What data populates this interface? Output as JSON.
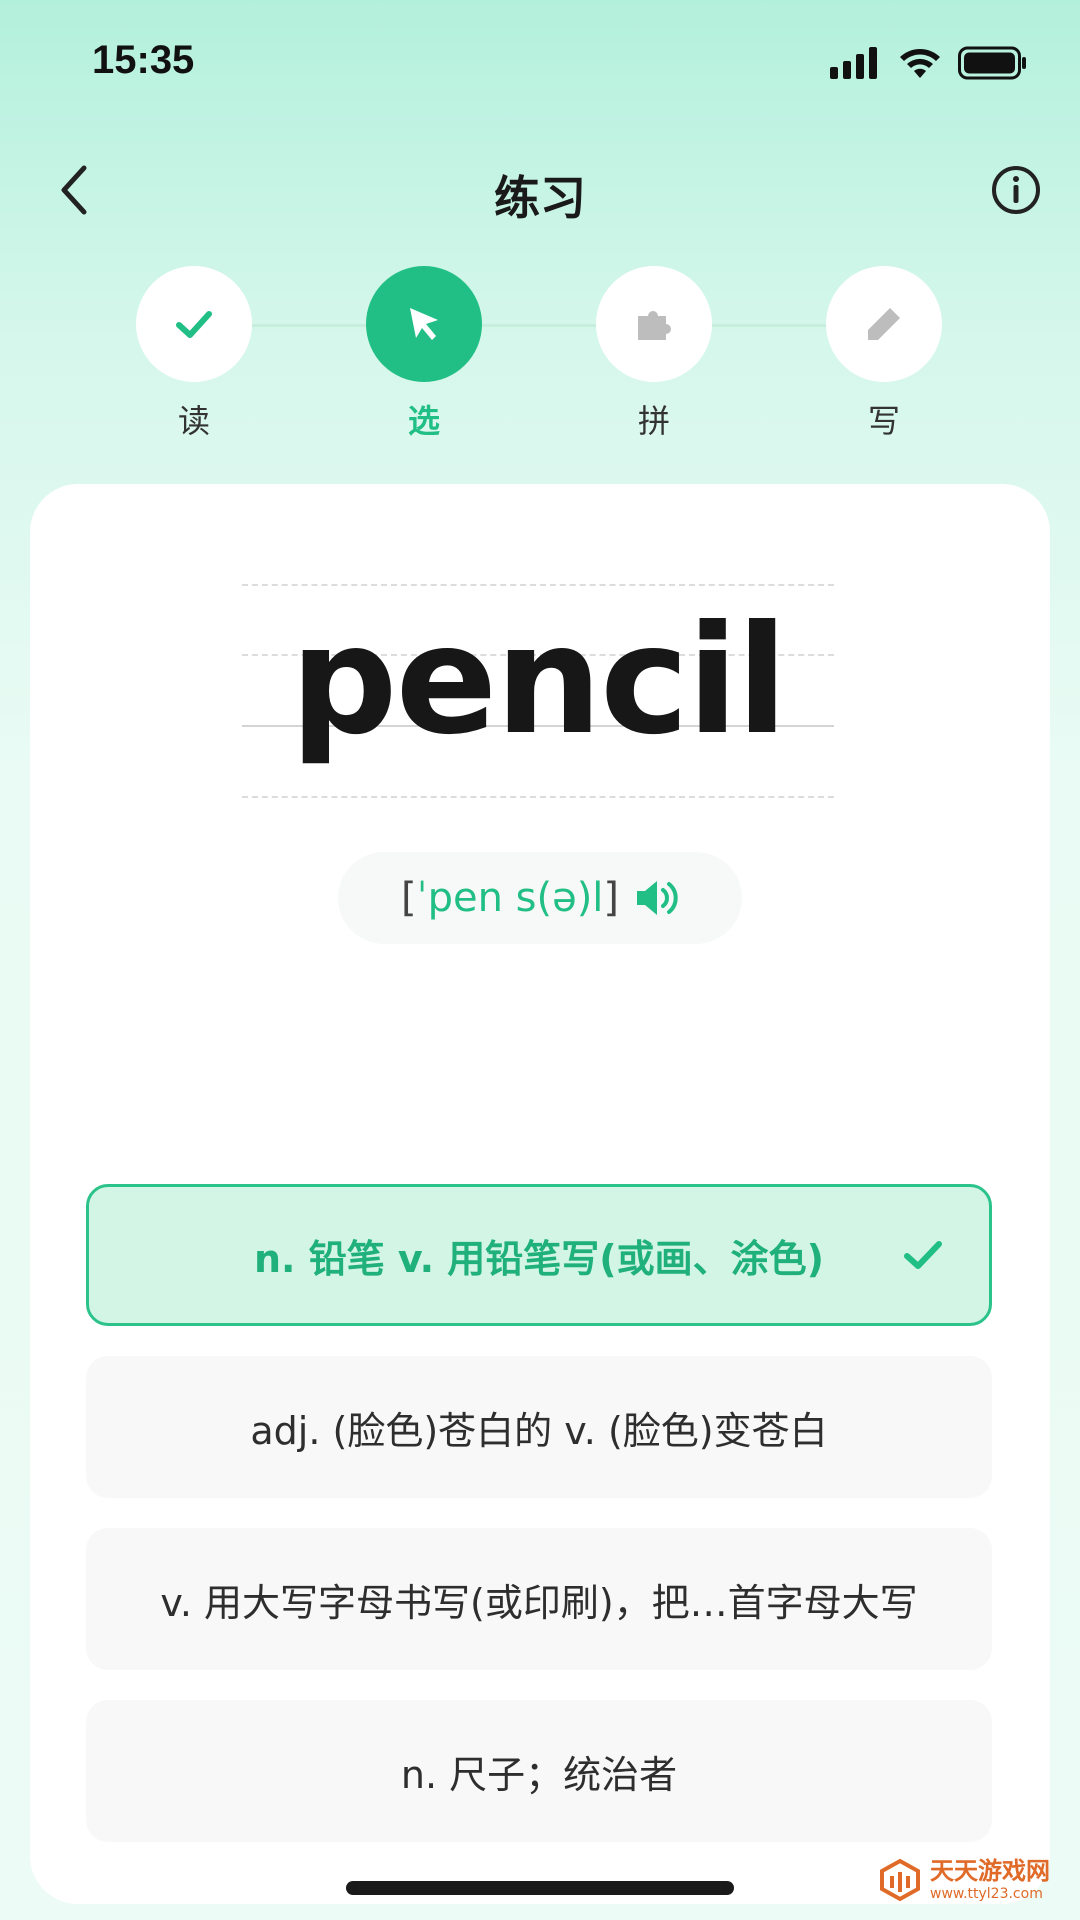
{
  "status_bar": {
    "time": "15:35",
    "icons": [
      "signal-icon",
      "wifi-icon",
      "battery-icon"
    ]
  },
  "nav": {
    "title": "练习",
    "back_icon": "chevron-left-icon",
    "info_icon": "info-circle-icon"
  },
  "steps": [
    {
      "label": "读",
      "icon": "check-icon",
      "state": "done"
    },
    {
      "label": "选",
      "icon": "cursor-icon",
      "state": "active"
    },
    {
      "label": "拼",
      "icon": "puzzle-icon",
      "state": "pending"
    },
    {
      "label": "写",
      "icon": "pencil-icon",
      "state": "pending"
    }
  ],
  "word": {
    "text": "pencil",
    "phonetic_open": "[",
    "phonetic_ipa": "ˈpen s(ə)l",
    "phonetic_close": "]",
    "speaker_icon": "speaker-icon"
  },
  "options": [
    {
      "text": "n. 铅笔    v. 用铅笔写(或画、涂色)",
      "state": "correct"
    },
    {
      "text": "adj. (脸色)苍白的    v. (脸色)变苍白",
      "state": "default"
    },
    {
      "text": "v. 用大写字母书写(或印刷)，把…首字母大写",
      "state": "default"
    },
    {
      "text": "n. 尺子；统治者",
      "state": "default"
    }
  ],
  "watermark": {
    "name": "天天游戏网",
    "url": "www.ttyl23.com"
  },
  "colors": {
    "accent": "#21bf85",
    "correct_bg": "#d3f5e6",
    "option_bg": "#f8f8f8"
  }
}
